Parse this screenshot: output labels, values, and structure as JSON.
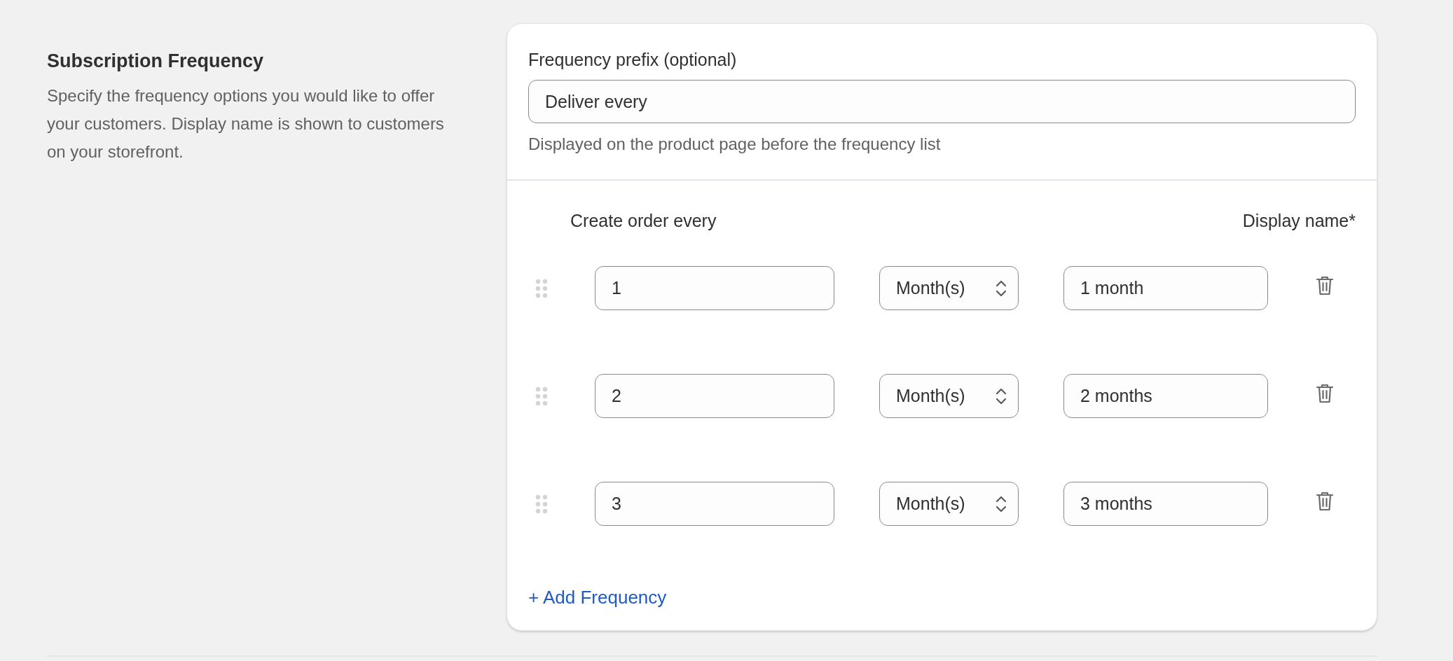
{
  "section": {
    "title": "Subscription Frequency",
    "description": "Specify the frequency options you would like to offer your customers. Display name is shown to customers on your storefront."
  },
  "prefix": {
    "label": "Frequency prefix (optional)",
    "value": "Deliver every",
    "help": "Displayed on the product page before the frequency list"
  },
  "columns": {
    "interval": "Create order every",
    "display_name": "Display name*"
  },
  "frequencies": [
    {
      "count": "1",
      "unit": "Month(s)",
      "display_name": "1 month"
    },
    {
      "count": "2",
      "unit": "Month(s)",
      "display_name": "2 months"
    },
    {
      "count": "3",
      "unit": "Month(s)",
      "display_name": "3 months"
    }
  ],
  "add_link": "+ Add Frequency"
}
